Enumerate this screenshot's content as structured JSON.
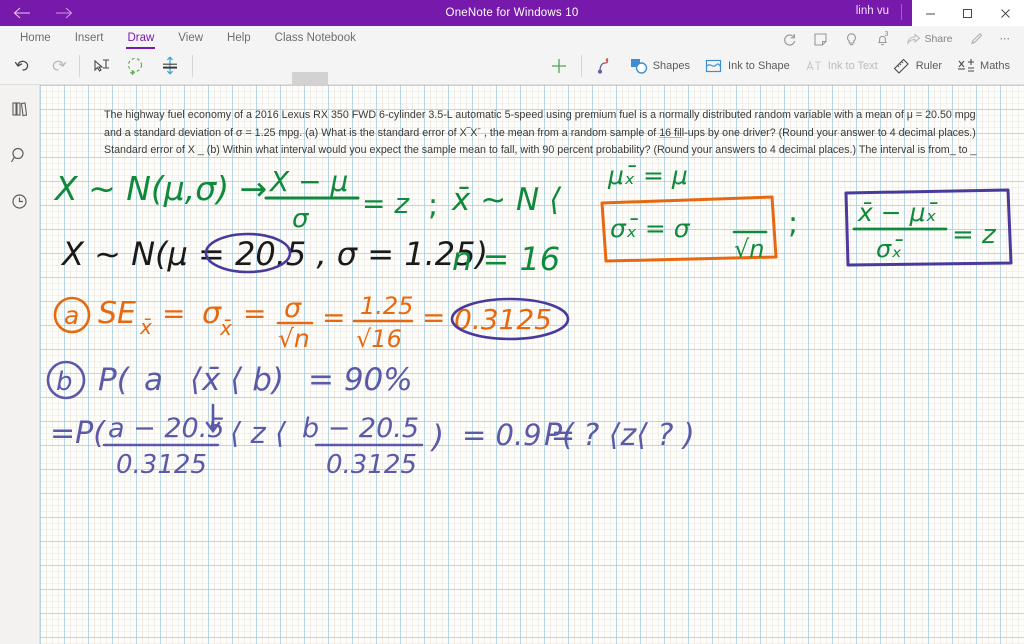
{
  "window": {
    "title": "OneNote for Windows 10",
    "user": "linh vu",
    "back_icon": "back-arrow-icon",
    "forward_icon": "forward-arrow-icon",
    "minimize_label": "minimize-icon",
    "maximize_label": "maximize-icon",
    "close_label": "close-icon",
    "accent_color": "#7719aa"
  },
  "ribbon": {
    "tabs": [
      {
        "label": "Home",
        "active": false
      },
      {
        "label": "Insert",
        "active": false
      },
      {
        "label": "Draw",
        "active": true
      },
      {
        "label": "View",
        "active": false
      },
      {
        "label": "Help",
        "active": false
      },
      {
        "label": "Class Notebook",
        "active": false
      }
    ],
    "left_tools": [
      {
        "name": "undo-button",
        "icon": "undo-icon",
        "label": "Undo"
      },
      {
        "name": "redo-button",
        "icon": "redo-icon",
        "label": "Redo"
      },
      {
        "name": "lasso-select-button",
        "icon": "lasso-select-icon",
        "label": "Lasso Select"
      },
      {
        "name": "add-pen-button",
        "icon": "add-pen-icon",
        "label": "Add Pen"
      },
      {
        "name": "thickness-button",
        "icon": "thickness-icon",
        "label": "Thickness"
      }
    ],
    "pen_swatch": {
      "name": "pen-color-dropdown",
      "icon": "chevron-down-icon"
    },
    "right_tools": [
      {
        "name": "insert-space-button",
        "icon": "plus-icon",
        "label": ""
      },
      {
        "name": "ink-eraser-button",
        "icon": "ink-eraser-icon",
        "label": ""
      },
      {
        "name": "shapes-button",
        "icon": "shapes-icon",
        "label": "Shapes",
        "disabled": false
      },
      {
        "name": "ink-to-shape-button",
        "icon": "ink-to-shape-icon",
        "label": "Ink to Shape",
        "disabled": false
      },
      {
        "name": "ink-to-text-button",
        "icon": "ink-to-text-icon",
        "label": "Ink to Text",
        "disabled": true
      },
      {
        "name": "ruler-button",
        "icon": "ruler-icon",
        "label": "Ruler",
        "disabled": false
      },
      {
        "name": "maths-button",
        "icon": "maths-icon",
        "label": "Maths",
        "disabled": false
      }
    ],
    "top_right_tools": [
      {
        "name": "sync-button",
        "icon": "sync-icon",
        "label": ""
      },
      {
        "name": "sticky-note-button",
        "icon": "sticky-note-icon",
        "label": ""
      },
      {
        "name": "tell-me-button",
        "icon": "lightbulb-icon",
        "label": ""
      },
      {
        "name": "notifications-button",
        "icon": "bell-icon",
        "label": "",
        "badge": "3"
      },
      {
        "name": "share-button",
        "icon": "share-icon",
        "label": "Share",
        "disabled": true
      },
      {
        "name": "pen-button",
        "icon": "pen-icon",
        "label": ""
      },
      {
        "name": "more-options-button",
        "icon": "ellipsis-icon",
        "label": "⋯"
      }
    ]
  },
  "rail": {
    "items": [
      {
        "name": "sidebar-item-notebooks",
        "icon": "notebooks-icon"
      },
      {
        "name": "sidebar-item-search",
        "icon": "search-icon"
      },
      {
        "name": "sidebar-item-recent",
        "icon": "clock-icon"
      }
    ]
  },
  "page": {
    "problem_text_parts": {
      "p1": "The highway fuel economy of a 2016 Lexus RX 350 FWD 6-cylinder 3.5-L automatic 5-speed using premium fuel is a normally distributed random variable with a mean of μ = 20.50 mpg and a standard deviation of σ = 1.25 mpg. (a) What is the standard error of X‾Xˉ , the mean from a random sample of ",
      "underlined": "16 fil",
      "p2": "l-ups by one driver? (Round your answer to 4 decimal places.) Standard error of X _ (b) Within what interval would you expect the sample mean to fall, with 90 percent probability? (Round your answers to 4 decimal places.) The interval is from_ to _"
    }
  },
  "ink": {
    "colors": {
      "green": "#0f8a3c",
      "black": "#1a1a1a",
      "orange": "#e8680f",
      "purple": "#4b3a9c",
      "indigo": "#5b59a8"
    },
    "line1": {
      "lhs": "X ∼ N(μ,σ) →",
      "frac_num": "X − μ",
      "frac_den": "σ",
      "eq_z": "= z",
      "semicolon": ";",
      "xbar_dist": "x̄ ∼ N ⟨",
      "mu_xbar": "μₓ̄ = μ",
      "sigma_xbar_num": "σₓ̄ = σ",
      "sigma_xbar_den": "√n",
      "semicolon2": ";",
      "boxed_num": "x̄ − μₓ̄",
      "boxed_den": "σₓ̄",
      "boxed_eq": "= z"
    },
    "line2": {
      "text": "X ∼ N(μ = 20.5 , σ = 1.25)",
      "circled": "20.5",
      "n_value": "n = 16"
    },
    "line_a": {
      "label": "a",
      "text": "SEₓ̄ = σₓ̄ = σ/√n = 1.25/√16 =",
      "se_label": "SE",
      "sub1": "x̄",
      "sigma_sub": "σ",
      "sub2": "x̄",
      "num1": "σ",
      "den1": "√n",
      "num2": "1.25",
      "den2": "√16",
      "answer": "0.3125"
    },
    "line_b": {
      "label": "b",
      "text": "P(  a   ⟨x̄ ⟨ b) = 90%",
      "prob_open": "P(",
      "a_var": "a",
      "mid": "⟨x̄ ⟨ b)",
      "eq": "= 90%"
    },
    "line_c": {
      "prefix": "=P(",
      "num1": "a − 20.5",
      "den1": "0.3125",
      "mid": "⟨ z ⟨",
      "num2": "b − 20.5",
      "den2": "0.3125",
      "close": ")",
      "eq09": "= 0.9 =",
      "tail": "P(    ?    ⟨z⟨  ?   )",
      "arrow": "arrow-down-icon"
    }
  }
}
